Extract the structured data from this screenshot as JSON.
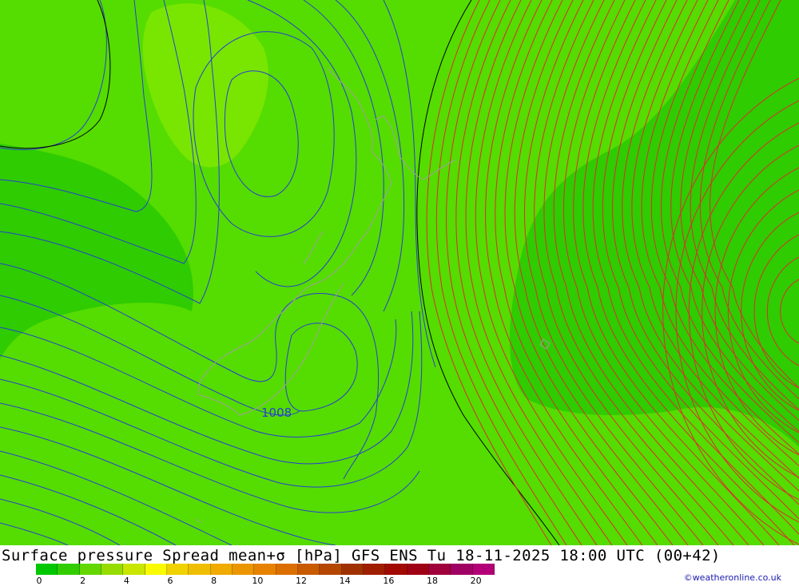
{
  "map": {
    "title": "Surface pressure Spread mean+σ [hPa] GFS ENS  Tu 18-11-2025 18:00 UTC (00+42)",
    "contour_label": "1008",
    "credit": "©weatheronline.co.uk",
    "legend": {
      "ticks": [
        "0",
        "2",
        "4",
        "6",
        "8",
        "10",
        "12",
        "14",
        "16",
        "18",
        "20"
      ],
      "colors": [
        "#00c800",
        "#32cd00",
        "#64d700",
        "#96dc00",
        "#c8e600",
        "#fafa00",
        "#f0d200",
        "#f0be00",
        "#f0aa00",
        "#eb9600",
        "#e68200",
        "#dc6e00",
        "#c85a00",
        "#b44600",
        "#a03200",
        "#a01e00",
        "#a00a00",
        "#a00014",
        "#a0003c",
        "#a00064",
        "#b40078"
      ]
    },
    "colors": {
      "background": "#55dc00",
      "dark_green": "#2ecc00",
      "light_green": "#78e600",
      "isobar_blue": "#2a3fd0",
      "isobar_red": "#d83030",
      "coast": "#a0a0a0"
    }
  }
}
